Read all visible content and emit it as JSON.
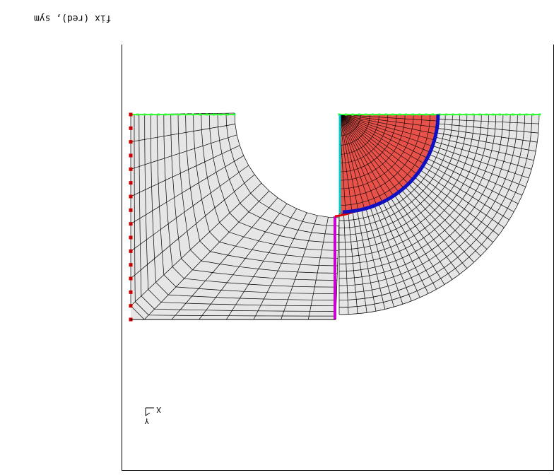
{
  "legend": {
    "text": "fix (red), sym"
  },
  "triad": {
    "x_label": "X",
    "y_label": "Y"
  },
  "colors": {
    "background": "#ffffff",
    "mesh_fill": "#e6e6e6",
    "mesh_line": "#000000",
    "red_region": "#e8524a",
    "fixed_bc": "#cc0000",
    "symmetry_bc": "#33ff33",
    "cyan_edge": "#00cccc",
    "magenta_edge": "#cc00cc",
    "blue_arc": "#1010c0",
    "red_arc": "#dd0000"
  }
}
